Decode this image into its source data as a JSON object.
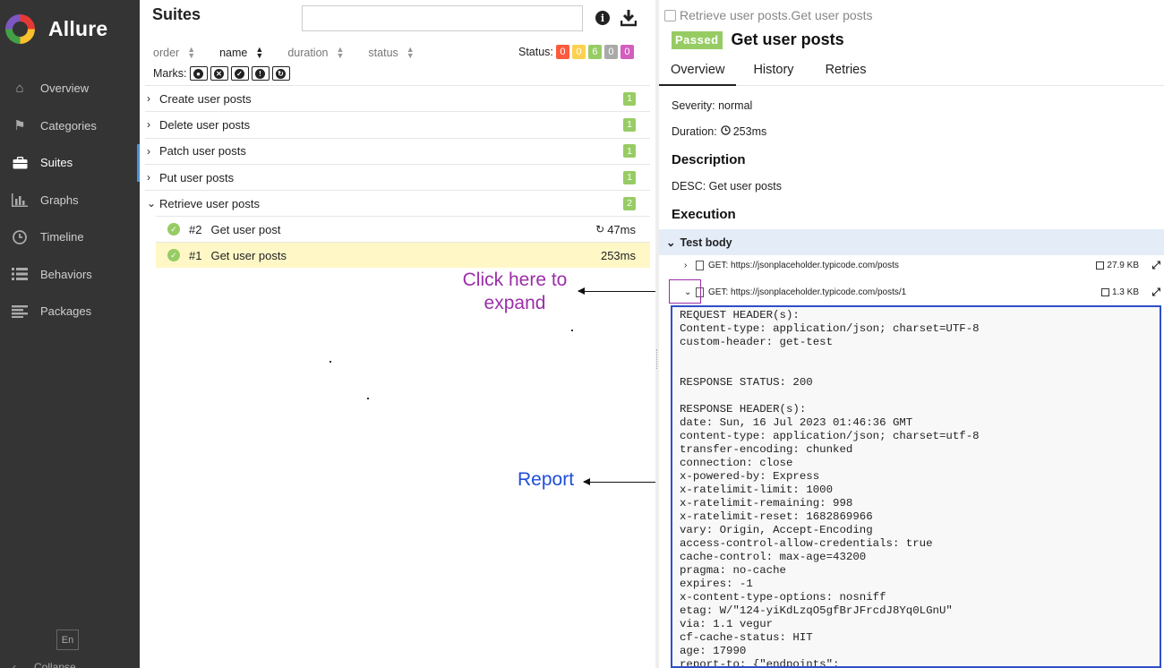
{
  "sidebar": {
    "brand": "Allure",
    "items": [
      {
        "label": "Overview",
        "icon": "home-icon"
      },
      {
        "label": "Categories",
        "icon": "flag-icon"
      },
      {
        "label": "Suites",
        "icon": "briefcase-icon",
        "active": true
      },
      {
        "label": "Graphs",
        "icon": "bar-chart-icon"
      },
      {
        "label": "Timeline",
        "icon": "clock-icon"
      },
      {
        "label": "Behaviors",
        "icon": "list-icon"
      },
      {
        "label": "Packages",
        "icon": "align-left-icon"
      }
    ],
    "language": "En",
    "collapse_label": "Collapse"
  },
  "suites": {
    "title": "Suites",
    "search_value": "",
    "sort": {
      "order": "order",
      "name": "name",
      "duration": "duration",
      "status": "status"
    },
    "status_label": "Status:",
    "status_counts": [
      {
        "value": "0",
        "color": "#fd5a3e"
      },
      {
        "value": "0",
        "color": "#ffd050"
      },
      {
        "value": "6",
        "color": "#97cc64"
      },
      {
        "value": "0",
        "color": "#aaaaaa"
      },
      {
        "value": "0",
        "color": "#d35ebe"
      }
    ],
    "marks_label": "Marks:",
    "groups": [
      {
        "name": "Create user posts",
        "count": "1",
        "chevron": "›"
      },
      {
        "name": "Delete user posts",
        "count": "1",
        "chevron": "›"
      },
      {
        "name": "Patch user posts",
        "count": "1",
        "chevron": "›"
      },
      {
        "name": "Put user posts",
        "count": "1",
        "chevron": "›"
      },
      {
        "name": "Retrieve user posts",
        "count": "2",
        "chevron": "⌄"
      }
    ],
    "leaves": [
      {
        "num": "#2",
        "name": "Get user post",
        "duration": "47ms"
      },
      {
        "num": "#1",
        "name": "Get user posts",
        "duration": "253ms"
      }
    ]
  },
  "annotations": {
    "expand_line1": "Click here to",
    "expand_line2": "expand",
    "report": "Report"
  },
  "detail": {
    "breadcrumb": "Retrieve user posts.Get user posts",
    "status": "Passed",
    "title": "Get user posts",
    "tabs": [
      "Overview",
      "History",
      "Retries"
    ],
    "severity": "Severity: normal",
    "duration_label": "Duration:",
    "duration": "253ms",
    "description_heading": "Description",
    "description": "DESC: Get user posts",
    "execution_heading": "Execution",
    "test_body": "Test body",
    "attachments": [
      {
        "label": "GET: https://jsonplaceholder.typicode.com/posts",
        "size": "27.9 KB"
      },
      {
        "label": "GET: https://jsonplaceholder.typicode.com/posts/1",
        "size": "1.3 KB"
      }
    ],
    "report_lines": [
      "REQUEST HEADER(s):",
      "Content-type: application/json; charset=UTF-8",
      "custom-header: get-test",
      "",
      "",
      "RESPONSE STATUS: 200",
      "",
      "RESPONSE HEADER(s):",
      "date: Sun, 16 Jul 2023 01:46:36 GMT",
      "content-type: application/json; charset=utf-8",
      "transfer-encoding: chunked",
      "connection: close",
      "x-powered-by: Express",
      "x-ratelimit-limit: 1000",
      "x-ratelimit-remaining: 998",
      "x-ratelimit-reset: 1682869966",
      "vary: Origin, Accept-Encoding",
      "access-control-allow-credentials: true",
      "cache-control: max-age=43200",
      "pragma: no-cache",
      "expires: -1",
      "x-content-type-options: nosniff",
      "etag: W/\"124-yiKdLzqO5gfBrJFrcdJ8Yq0LGnU\"",
      "via: 1.1 vegur",
      "cf-cache-status: HIT",
      "age: 17990",
      "report-to: {\"endpoints\":"
    ]
  }
}
